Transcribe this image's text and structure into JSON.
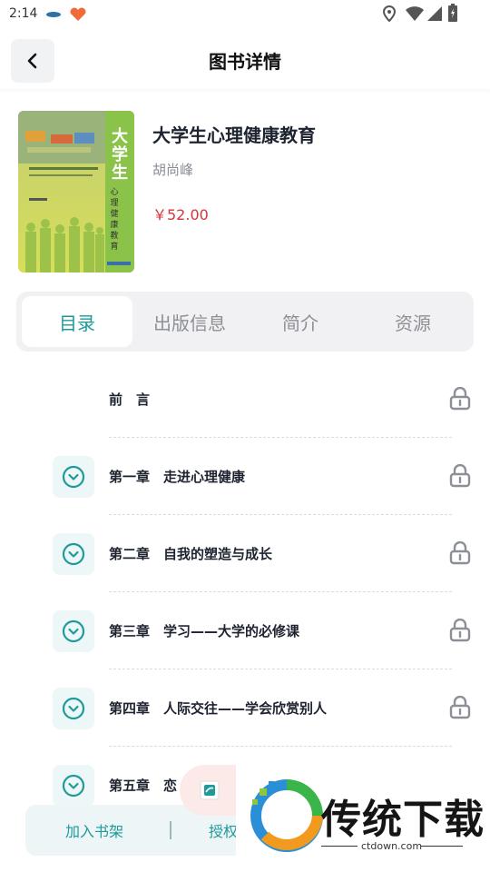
{
  "status_bar": {
    "time": "2:14"
  },
  "header": {
    "title": "图书详情"
  },
  "book": {
    "title": "大学生心理健康教育",
    "author": "胡尚峰",
    "price": "￥52.00",
    "cover": {
      "title_large": "大学生",
      "title_vertical": "心理健康教育"
    }
  },
  "tabs": [
    {
      "label": "目录",
      "active": true
    },
    {
      "label": "出版信息",
      "active": false
    },
    {
      "label": "简介",
      "active": false
    },
    {
      "label": "资源",
      "active": false
    }
  ],
  "chapters": [
    {
      "label": "前　言",
      "expandable": false,
      "locked": true
    },
    {
      "label": "第一章　走进心理健康",
      "expandable": true,
      "locked": true
    },
    {
      "label": "第二章　自我的塑造与成长",
      "expandable": true,
      "locked": true
    },
    {
      "label": "第三章　学习——大学的必修课",
      "expandable": true,
      "locked": true
    },
    {
      "label": "第四章　人际交往——学会欣赏别人",
      "expandable": true,
      "locked": true
    },
    {
      "label": "第五章　恋",
      "expandable": true,
      "locked": false
    }
  ],
  "bottom_bar": {
    "add_to_shelf": "加入书架",
    "authorize": "授权"
  },
  "watermark": {
    "brand": "传统下载",
    "domain": "ctdown.com"
  },
  "colors": {
    "accent": "#1e9a9a",
    "price": "#d9343a"
  }
}
